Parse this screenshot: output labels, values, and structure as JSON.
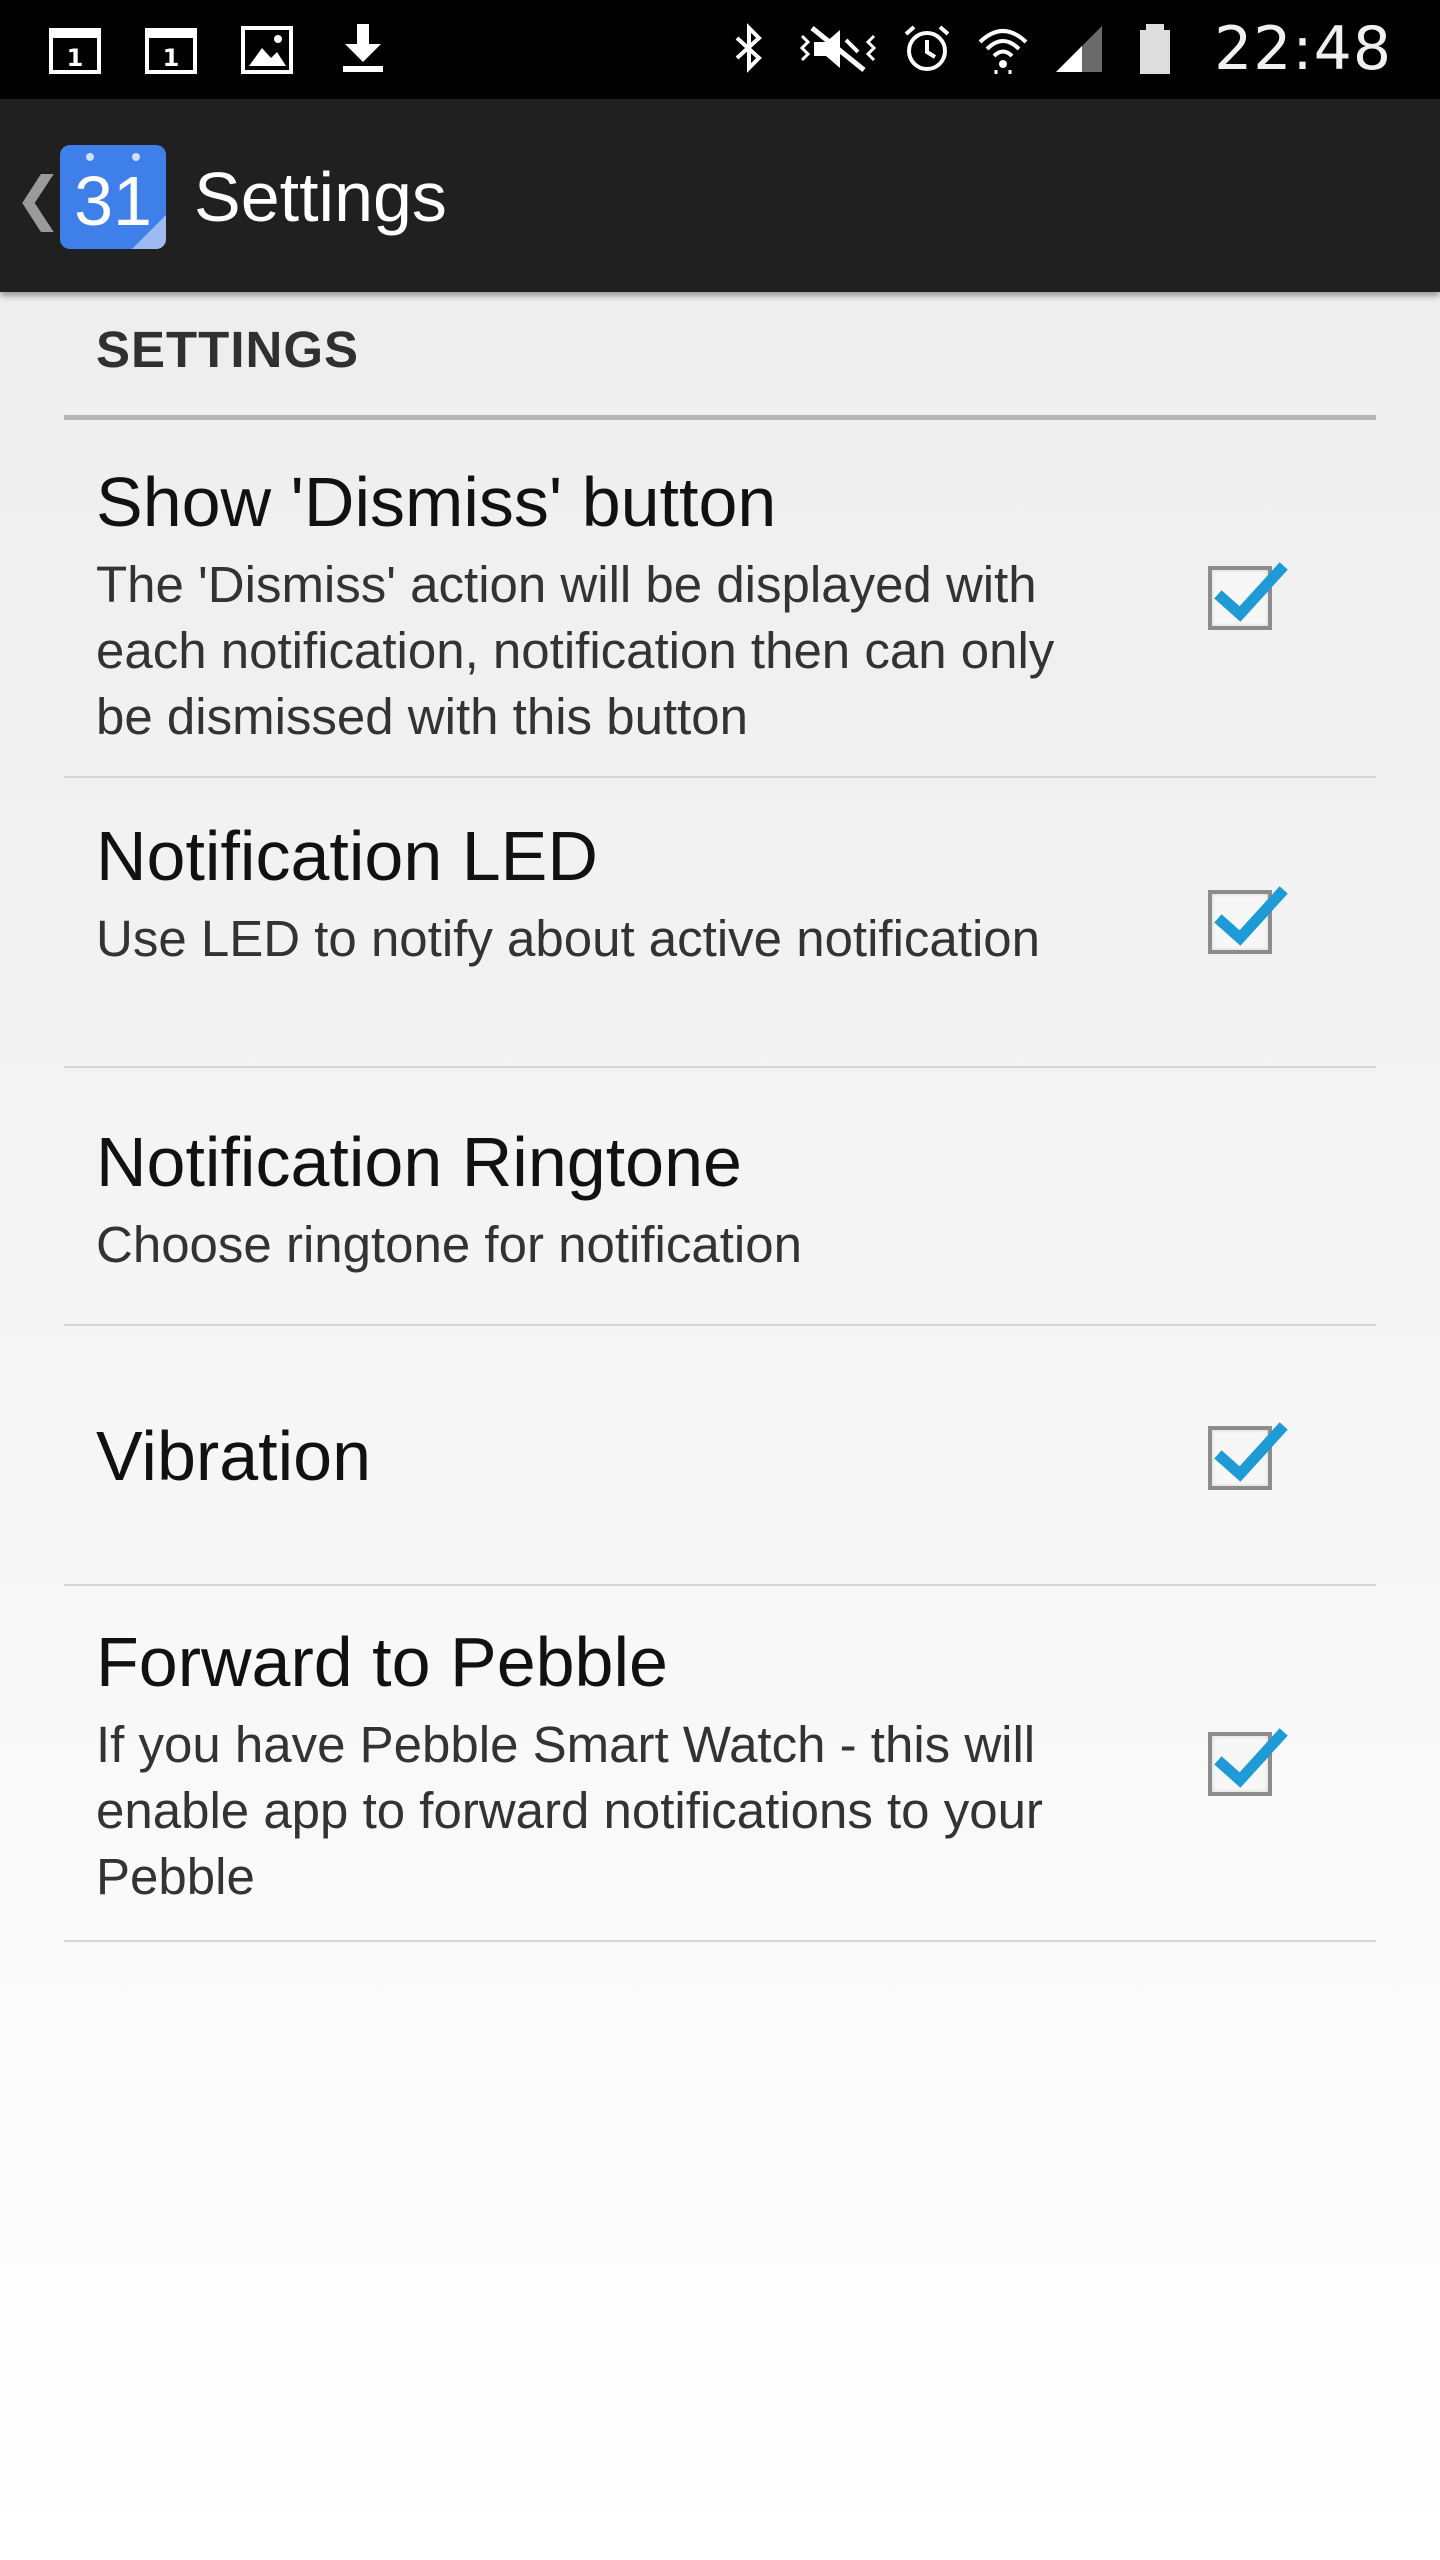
{
  "status_bar": {
    "left_icons": [
      "calendar-notification-icon",
      "calendar-notification-icon",
      "gallery-notification-icon",
      "download-icon"
    ],
    "right_icons": [
      "bluetooth-icon",
      "mute-vibrate-icon",
      "alarm-icon",
      "wifi-icon",
      "signal-icon",
      "battery-icon"
    ],
    "calendar_badge_1": "1",
    "calendar_badge_2": "1",
    "time": "22:48"
  },
  "action_bar": {
    "app_icon_number": "31",
    "title": "Settings"
  },
  "category": {
    "title": "SETTINGS"
  },
  "preferences": [
    {
      "title": "Show 'Dismiss' button",
      "summary": "The 'Dismiss' action will be displayed with each notification, notification then can only be dismissed with this button",
      "checked": true
    },
    {
      "title": "Notification LED",
      "summary": "Use LED to notify about active notification",
      "checked": true
    },
    {
      "title": "Notification Ringtone",
      "summary": "Choose ringtone for notification"
    },
    {
      "title": "Vibration",
      "checked": true
    },
    {
      "title": "Forward to Pebble",
      "summary": "If you have Pebble Smart Watch - this will enable app to forward notifications to your Pebble",
      "checked": true
    }
  ],
  "colors": {
    "checkmark": "#1e9bd7",
    "app_icon": "#3f7fe9",
    "action_bar": "#202020"
  }
}
